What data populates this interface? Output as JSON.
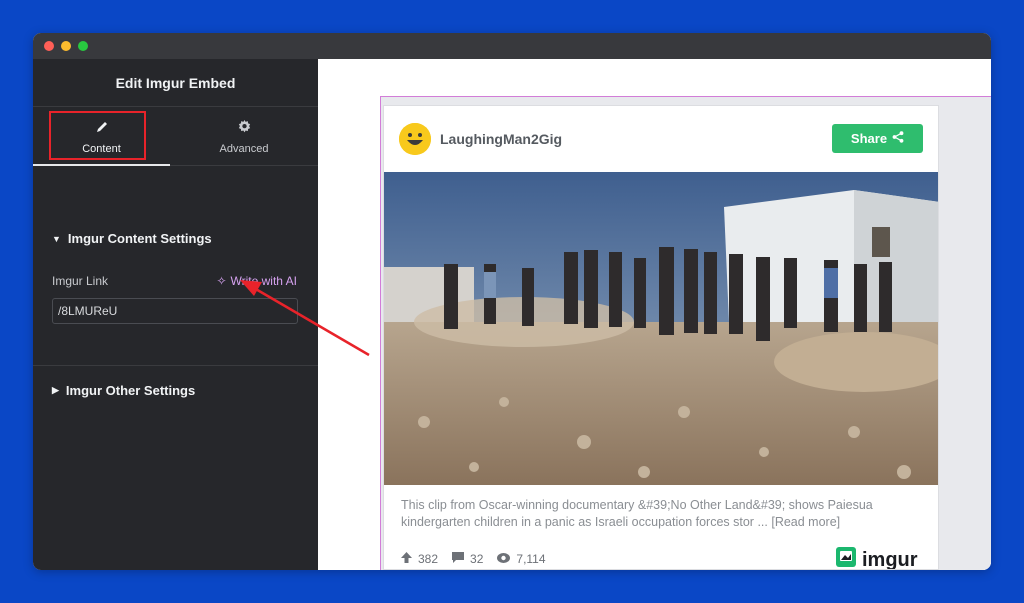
{
  "sidebar": {
    "title": "Edit Imgur Embed",
    "tabs": [
      {
        "label": "Content",
        "icon": "pencil-icon"
      },
      {
        "label": "Advanced",
        "icon": "gear-icon"
      }
    ],
    "section_content": "Imgur Content Settings",
    "field_label": "Imgur Link",
    "ai_link": "Write with AI",
    "field_value": "/8LMUReU",
    "section_other": "Imgur Other Settings"
  },
  "preview": {
    "username": "LaughingMan2Gig",
    "share_label": "Share",
    "caption": "This clip from Oscar-winning documentary &#39;No Other Land&#39; shows Paiesua kindergarten children in a panic as Israeli occupation forces stor ...",
    "read_more": "[Read more]",
    "stats": {
      "upvotes": "382",
      "comments": "32",
      "views": "7,114"
    },
    "logo_text": "imgur"
  },
  "colors": {
    "background": "#0a47c6",
    "sidebar": "#26272b",
    "share": "#2fbd6e",
    "highlight": "#e8232a",
    "ai_accent": "#d6a2f0"
  }
}
